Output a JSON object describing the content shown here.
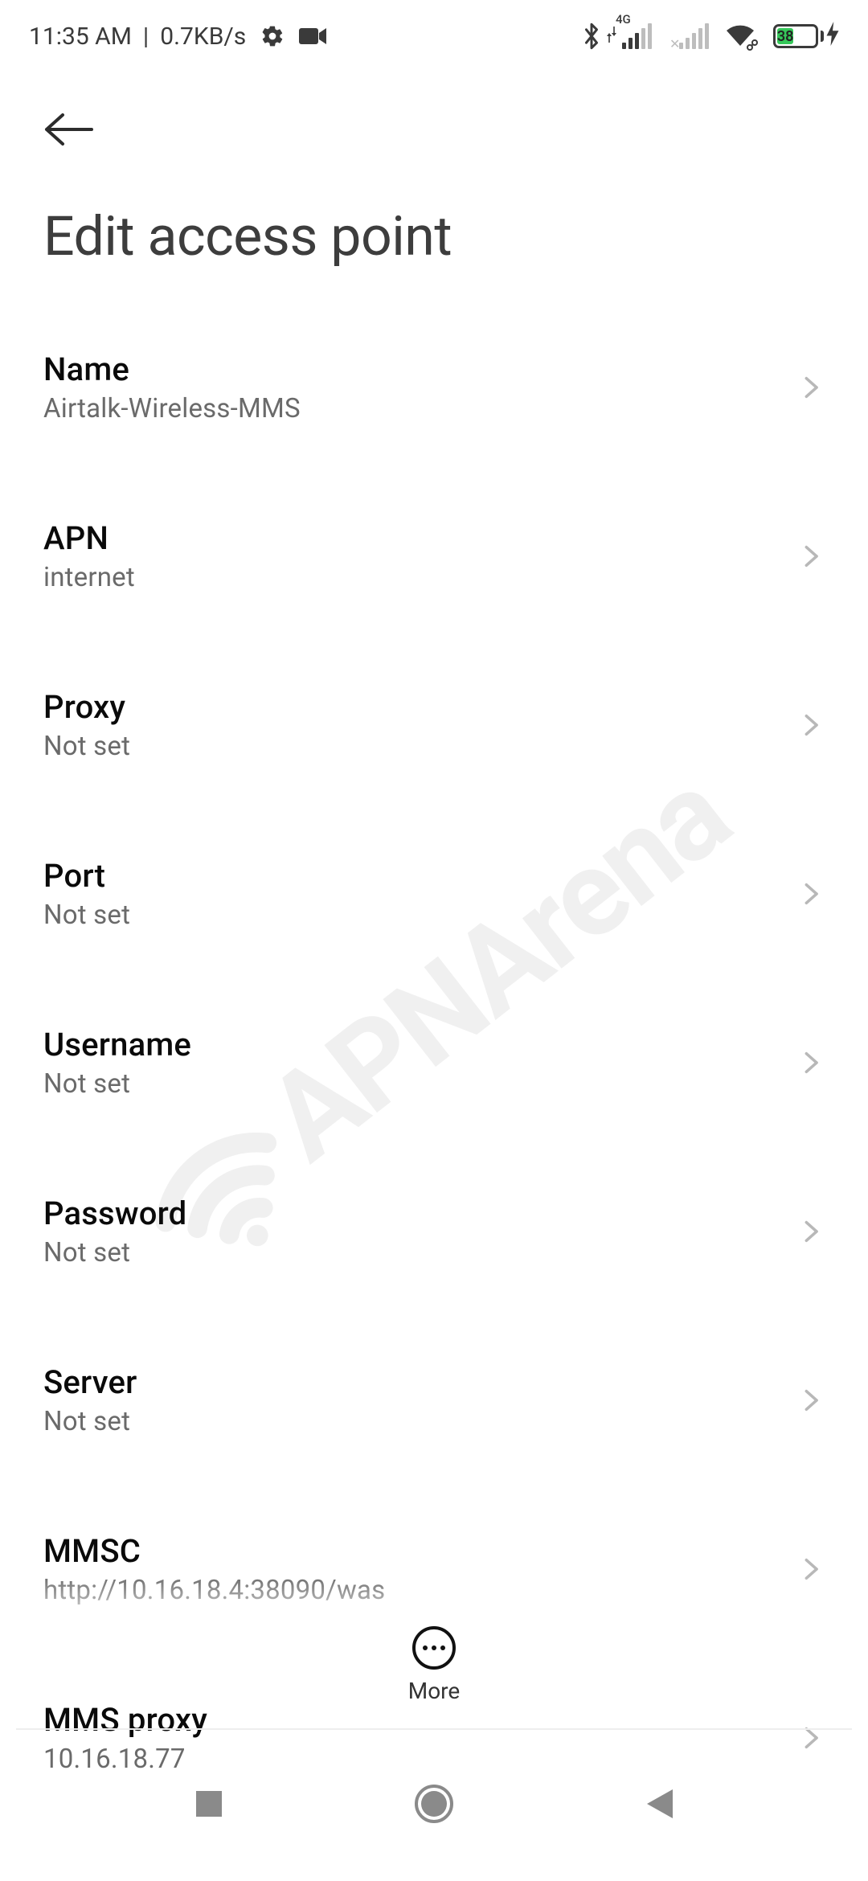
{
  "status": {
    "time": "11:35 AM",
    "separator": "|",
    "net_speed": "0.7KB/s",
    "signal1_label": "4G",
    "battery_pct": "38",
    "battery_fill_width": "44%"
  },
  "header": {
    "title": "Edit access point"
  },
  "rows": [
    {
      "title": "Name",
      "value": "Airtalk-Wireless-MMS"
    },
    {
      "title": "APN",
      "value": "internet"
    },
    {
      "title": "Proxy",
      "value": "Not set"
    },
    {
      "title": "Port",
      "value": "Not set"
    },
    {
      "title": "Username",
      "value": "Not set"
    },
    {
      "title": "Password",
      "value": "Not set"
    },
    {
      "title": "Server",
      "value": "Not set"
    },
    {
      "title": "MMSC",
      "value": "http://10.16.18.4:38090/was"
    },
    {
      "title": "MMS proxy",
      "value": "10.16.18.77"
    }
  ],
  "more": {
    "label": "More"
  },
  "watermark": {
    "text": "APNArena"
  }
}
